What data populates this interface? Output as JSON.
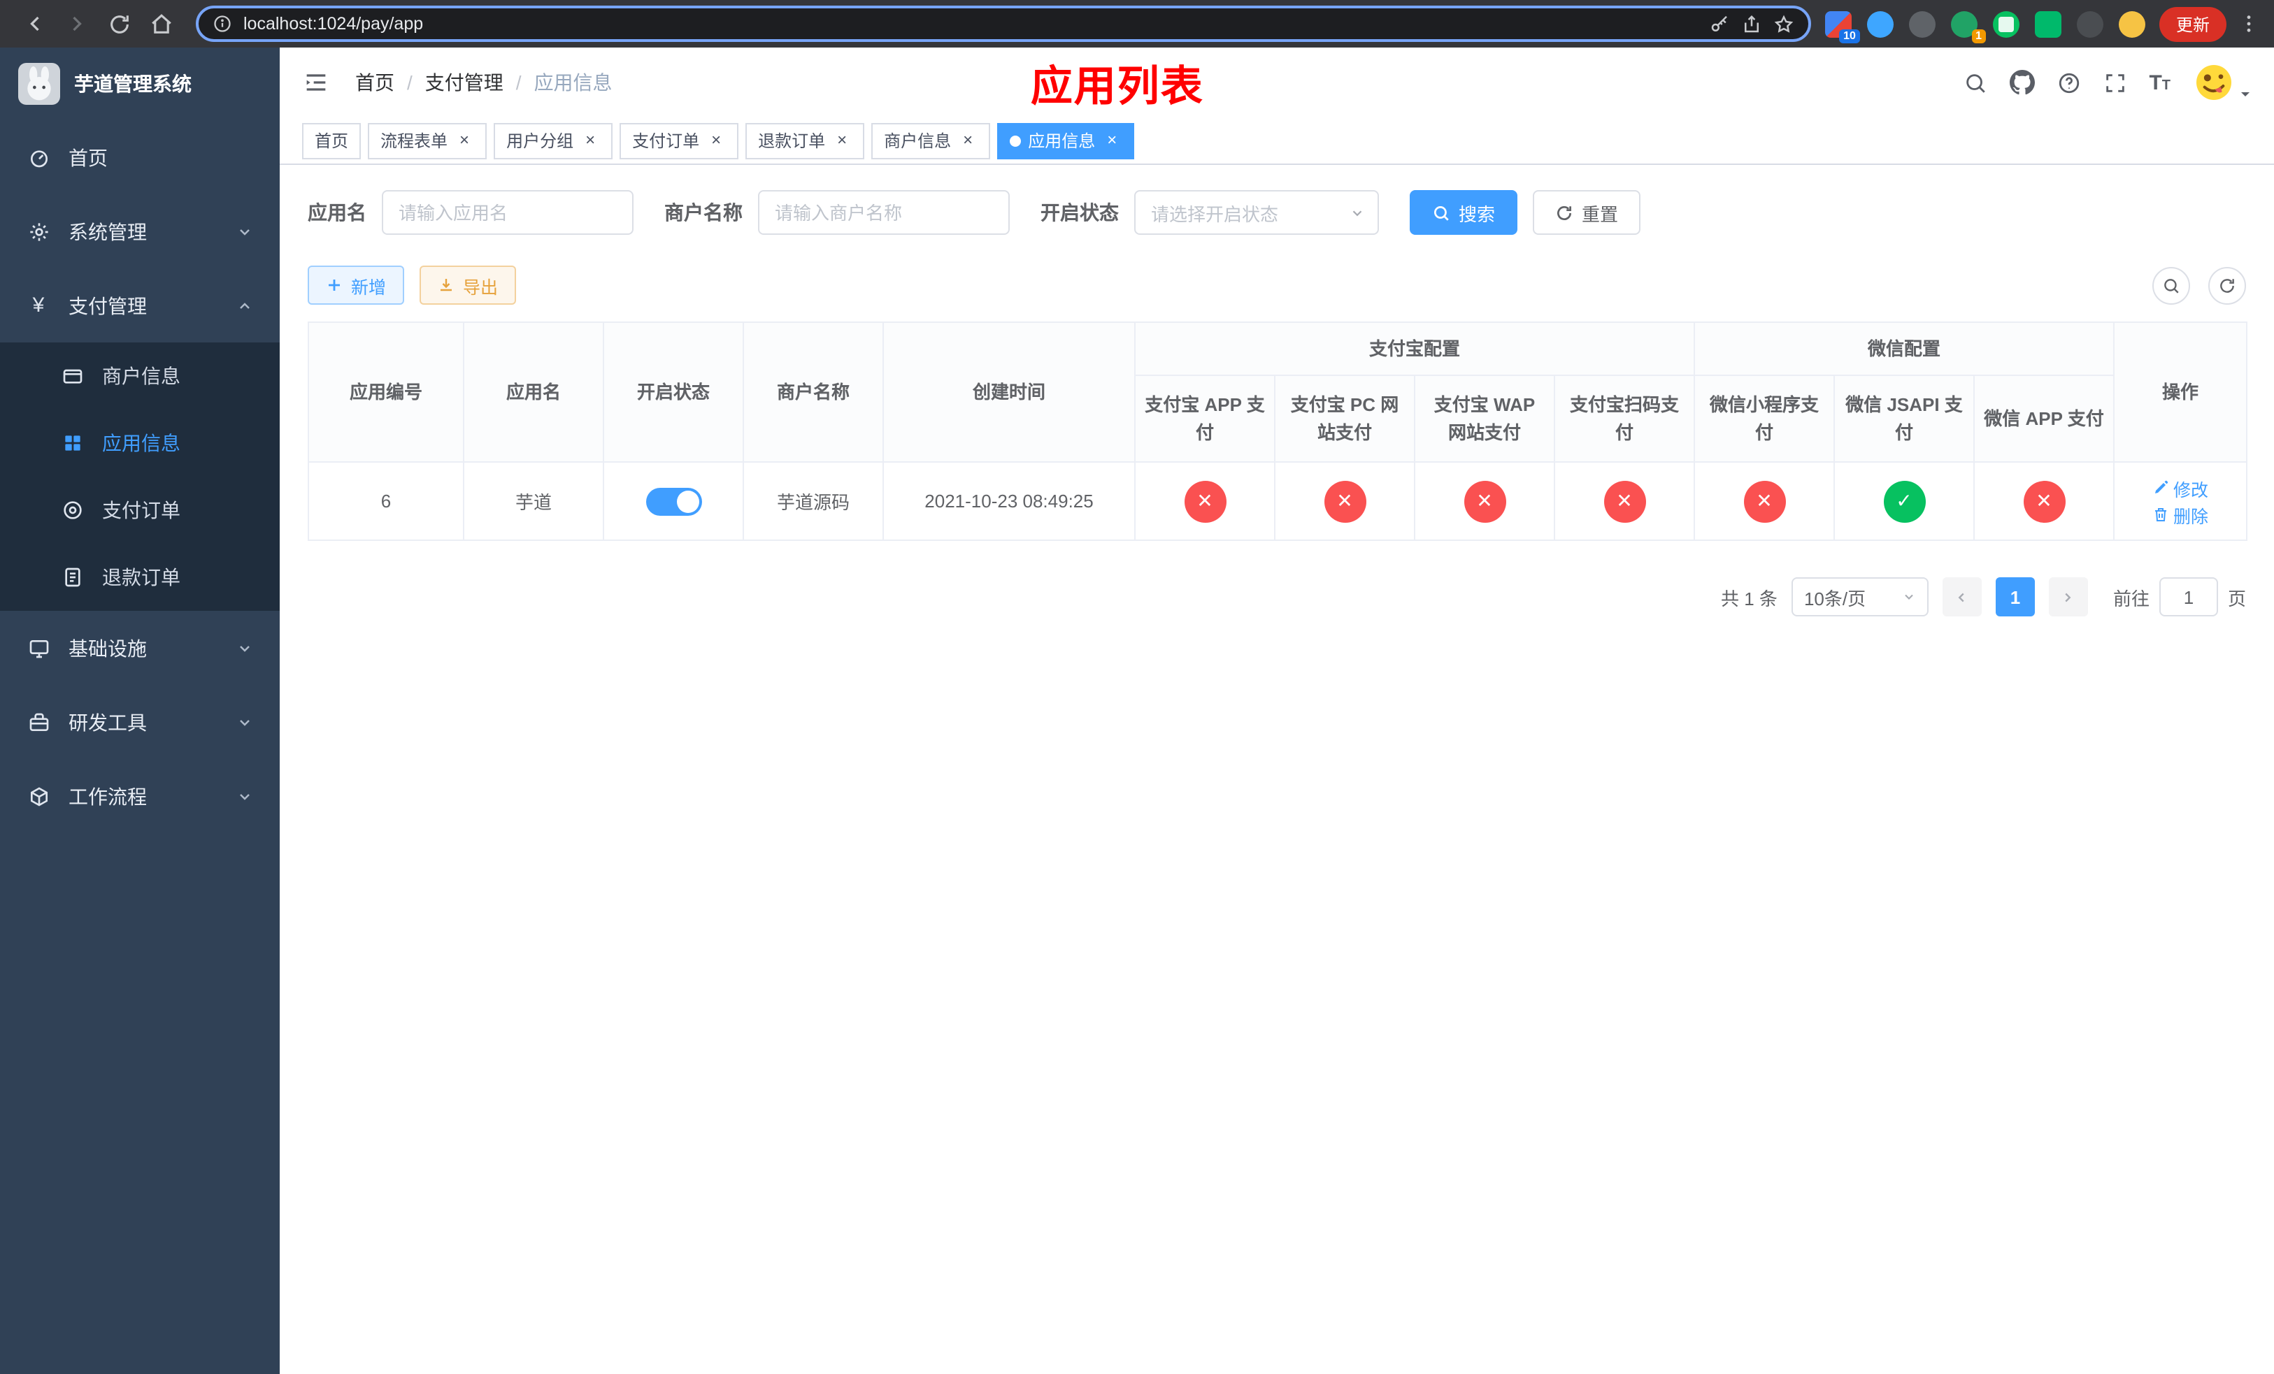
{
  "colors": {
    "primary": "#409eff",
    "danger": "#fa5151",
    "success": "#07c160",
    "warning": "#e6a23c",
    "overlay_title_red": "#ff0000",
    "sidebar_bg": "#304156",
    "submenu_bg": "#1f2d3d"
  },
  "browser": {
    "url": "localhost:1024/pay/app",
    "update_button": "更新",
    "extension_badge_1": "10",
    "extension_badge_2": "1"
  },
  "sidebar": {
    "logo_title": "芋道管理系统",
    "items": [
      {
        "label": "首页"
      },
      {
        "label": "系统管理"
      },
      {
        "label": "支付管理",
        "children": [
          {
            "label": "商户信息"
          },
          {
            "label": "应用信息"
          },
          {
            "label": "支付订单"
          },
          {
            "label": "退款订单"
          }
        ]
      },
      {
        "label": "基础设施"
      },
      {
        "label": "研发工具"
      },
      {
        "label": "工作流程"
      }
    ]
  },
  "navbar": {
    "breadcrumb": [
      "首页",
      "支付管理",
      "应用信息"
    ],
    "separator": "/",
    "overlay_title": "应用列表"
  },
  "tabs": [
    {
      "label": "首页"
    },
    {
      "label": "流程表单"
    },
    {
      "label": "用户分组"
    },
    {
      "label": "支付订单"
    },
    {
      "label": "退款订单"
    },
    {
      "label": "商户信息"
    },
    {
      "label": "应用信息"
    }
  ],
  "filters": {
    "app_name_label": "应用名",
    "app_name_placeholder": "请输入应用名",
    "merchant_label": "商户名称",
    "merchant_placeholder": "请输入商户名称",
    "status_label": "开启状态",
    "status_placeholder": "请选择开启状态",
    "search_button": "搜索",
    "reset_button": "重置"
  },
  "toolbar": {
    "add_button": "新增",
    "export_button": "导出"
  },
  "table": {
    "headers": {
      "app_id": "应用编号",
      "app_name": "应用名",
      "status": "开启状态",
      "merchant": "商户名称",
      "create_time": "创建时间",
      "alipay_group": "支付宝配置",
      "wechat_group": "微信配置",
      "alipay_app": "支付宝 APP 支付",
      "alipay_pc": "支付宝 PC 网站支付",
      "alipay_wap": "支付宝 WAP 网站支付",
      "alipay_qr": "支付宝扫码支付",
      "wx_lite": "微信小程序支付",
      "wx_jsapi": "微信 JSAPI 支付",
      "wx_app": "微信 APP 支付",
      "actions": "操作"
    },
    "rows": [
      {
        "app_id": "6",
        "app_name": "芋道",
        "status_on": true,
        "merchant": "芋道源码",
        "create_time": "2021-10-23 08:49:25",
        "configs": {
          "alipay_app": false,
          "alipay_pc": false,
          "alipay_wap": false,
          "alipay_qr": false,
          "wx_lite": false,
          "wx_jsapi": true,
          "wx_app": false
        },
        "edit_label": "修改",
        "delete_label": "删除"
      }
    ]
  },
  "pagination": {
    "total_text": "共 1 条",
    "page_size": "10条/页",
    "current_page": "1",
    "goto_prefix": "前往",
    "goto_value": "1",
    "goto_suffix": "页"
  }
}
